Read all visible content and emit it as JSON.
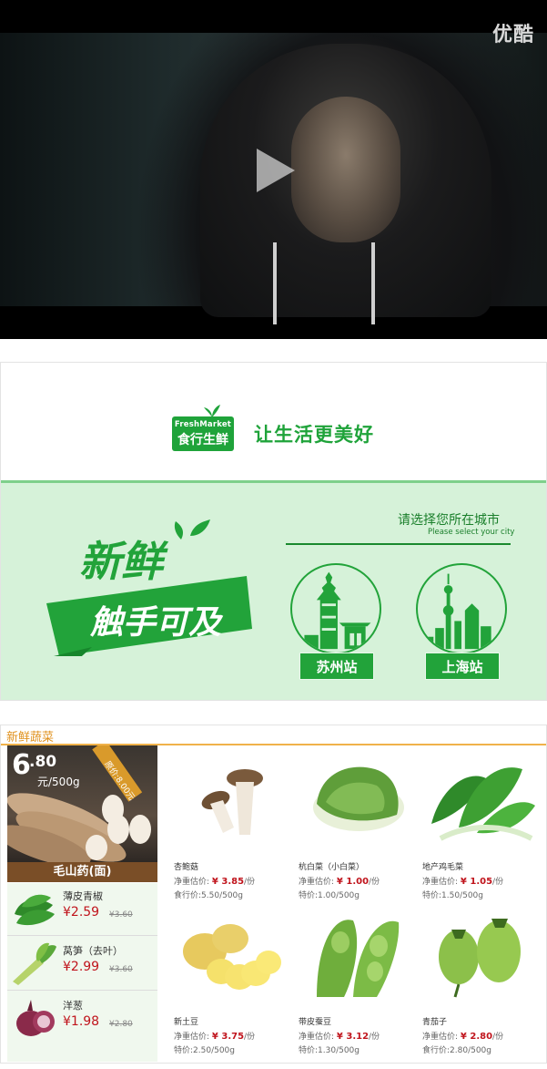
{
  "video": {
    "brand": "优酷",
    "play_icon": "play-icon"
  },
  "banner": {
    "logo_en": "FreshMarket",
    "logo_cn": "食行生鲜",
    "slogan": "让生活更美好",
    "graphic_line1": "新鲜",
    "graphic_line2": "触手可及",
    "city_prompt": "请选择您所在城市",
    "city_prompt_en": "Please select your city",
    "cities": [
      {
        "label": "苏州站"
      },
      {
        "label": "上海站"
      }
    ],
    "colors": {
      "green": "#22a33a",
      "light_green": "#d6f2d9"
    }
  },
  "produce": {
    "section_title": "新鲜蔬菜",
    "feature": {
      "price_int": "6",
      "price_dec": ".80",
      "unit": "元/500g",
      "original": "原价:8.00元",
      "name": "毛山药(面)"
    },
    "side_items": [
      {
        "name": "薄皮青椒",
        "price": "¥2.59",
        "original": "¥3.60"
      },
      {
        "name": "莴笋（去叶）",
        "price": "¥2.99",
        "original": "¥3.60"
      },
      {
        "name": "洋葱",
        "price": "¥1.98",
        "original": "¥2.80"
      }
    ],
    "cards": [
      {
        "name": "杏鲍菇",
        "est_label": "净重估价:",
        "est_price": "¥ 3.85",
        "est_unit": "/份",
        "sub": "食行价:5.50/500g"
      },
      {
        "name": "杭白菜（小白菜）",
        "est_label": "净重估价:",
        "est_price": "¥ 1.00",
        "est_unit": "/份",
        "sub": "特价:1.00/500g"
      },
      {
        "name": "地产鸡毛菜",
        "est_label": "净重估价:",
        "est_price": "¥ 1.05",
        "est_unit": "/份",
        "sub": "特价:1.50/500g"
      },
      {
        "name": "新土豆",
        "est_label": "净重估价:",
        "est_price": "¥ 3.75",
        "est_unit": "/份",
        "sub": "特价:2.50/500g"
      },
      {
        "name": "带皮蚕豆",
        "est_label": "净重估价:",
        "est_price": "¥ 3.12",
        "est_unit": "/份",
        "sub": "特价:1.30/500g"
      },
      {
        "name": "青茄子",
        "est_label": "净重估价:",
        "est_price": "¥ 2.80",
        "est_unit": "/份",
        "sub": "食行价:2.80/500g"
      }
    ]
  }
}
